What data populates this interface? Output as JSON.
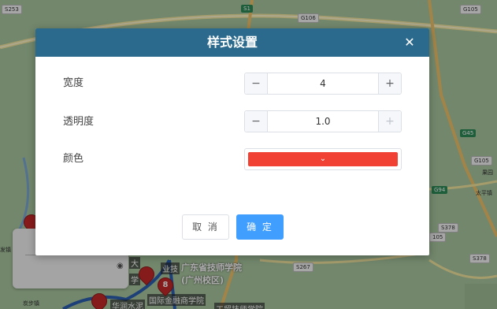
{
  "map": {
    "road_labels": [
      "S253",
      "S1",
      "G106",
      "G105",
      "G45",
      "G105",
      "G94",
      "S378",
      "S378",
      "S267",
      "105"
    ],
    "places": [
      "黄埔",
      "从化",
      "太平镇",
      "果园",
      "发镇",
      "炭步镇"
    ],
    "poi_texts": [
      "广东省技师学院",
      "(广州校区)",
      "国际金融商学院",
      "华润水泥",
      "工贸技师学院",
      "大",
      "业技",
      "学"
    ],
    "pins": [
      "8"
    ],
    "accent_route": "#2a5fb0",
    "pin_color": "#c62828"
  },
  "dialog": {
    "title": "样式设置",
    "close_icon": "close-icon",
    "header_color": "#2b6a8d",
    "fields": {
      "width": {
        "label": "宽度",
        "value": "4",
        "minus": "−",
        "plus": "+"
      },
      "opacity": {
        "label": "透明度",
        "value": "1.0",
        "minus": "−",
        "plus": "+",
        "plus_disabled": true
      },
      "color": {
        "label": "颜色",
        "value": "#f04134"
      }
    },
    "buttons": {
      "cancel": "取 消",
      "ok": "确 定"
    },
    "accent": "#409eff"
  }
}
